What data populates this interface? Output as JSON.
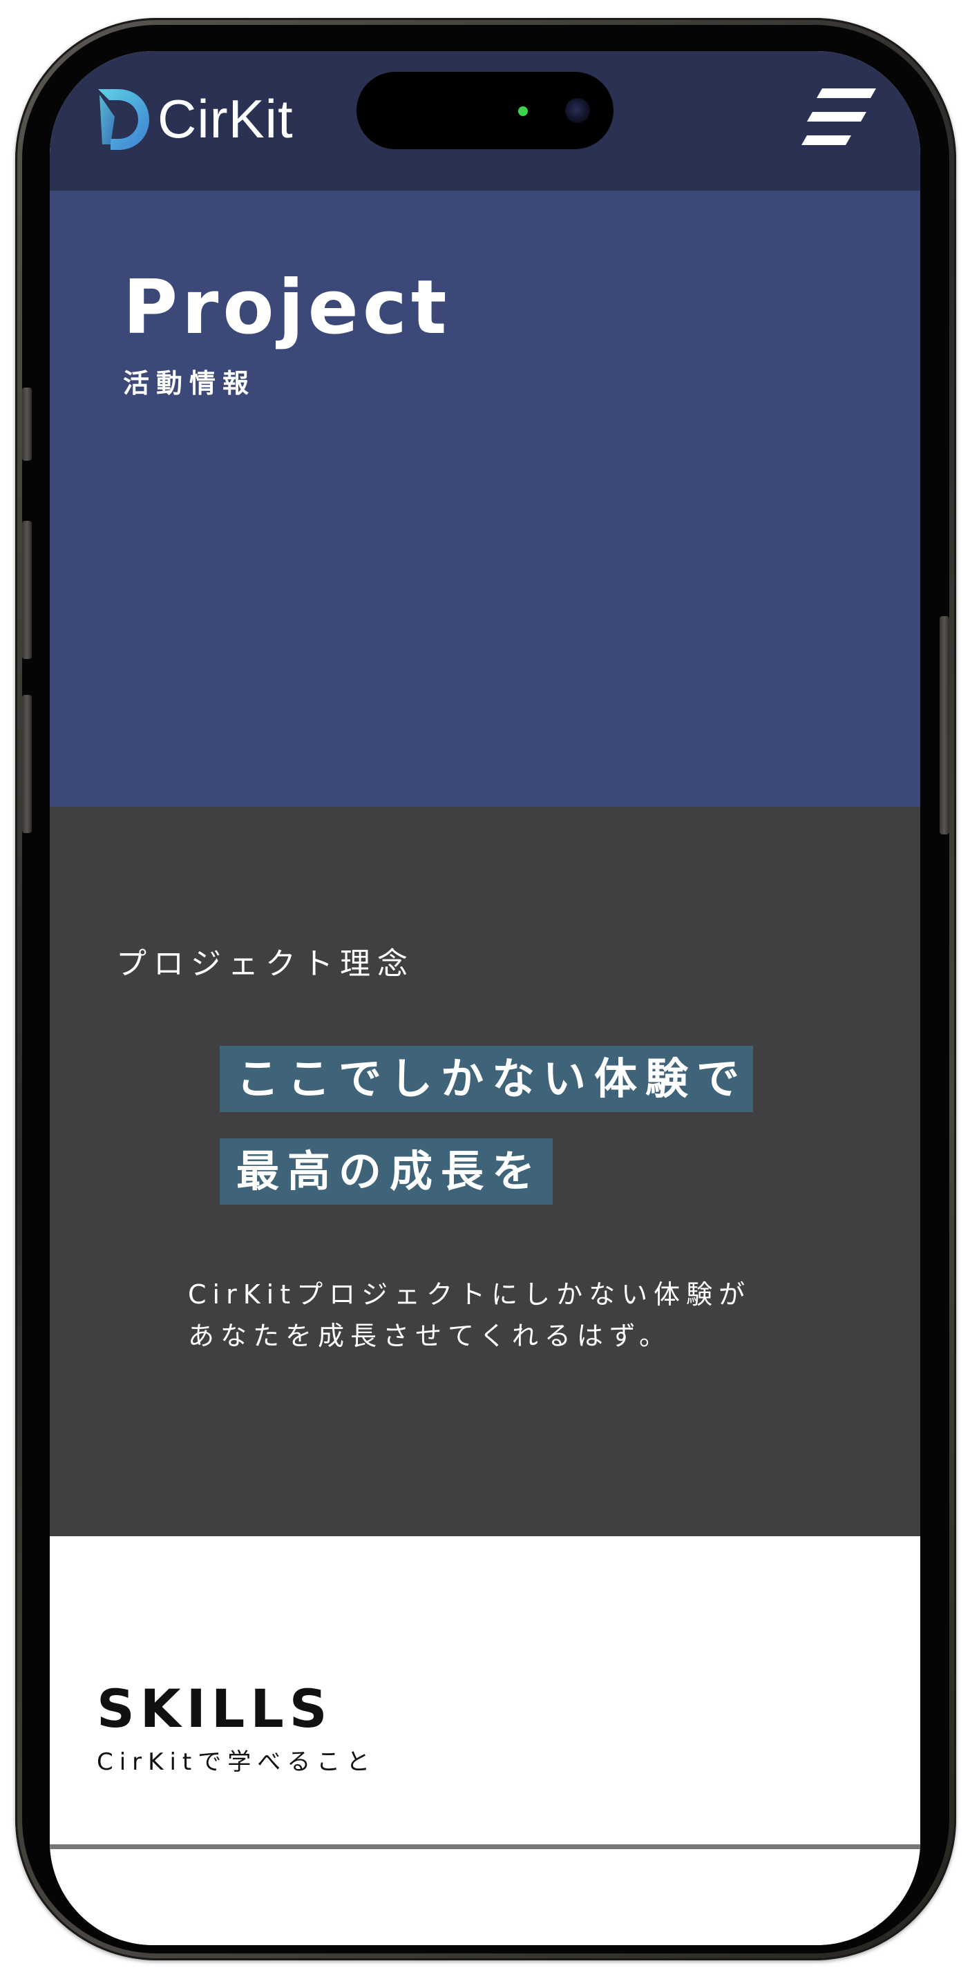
{
  "navbar": {
    "logo_text": "CirKit",
    "logo_icon": "cirkit-logo-mark",
    "menu_icon": "hamburger-menu-icon",
    "background": "#2a3152"
  },
  "hero": {
    "title": "Project",
    "subtitle": "活動情報",
    "background": "#3b4878"
  },
  "philosophy": {
    "heading": "プロジェクト理念",
    "tagline_lines": [
      "ここでしかない体験で",
      "最高の成長を"
    ],
    "description_lines": [
      "CirKitプロジェクトにしかない体験が",
      "あなたを成長させてくれるはず。"
    ],
    "background": "#404043",
    "highlight_color": "#3f6378"
  },
  "skills": {
    "title": "SKILLS",
    "subtitle": "CirKitで学べること"
  }
}
